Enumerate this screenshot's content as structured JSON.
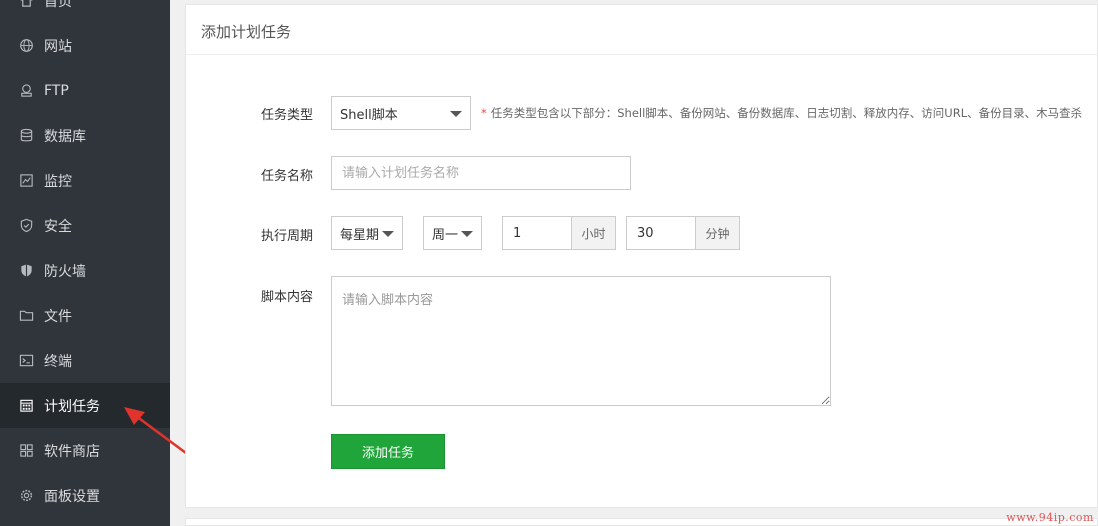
{
  "sidebar": {
    "items": [
      {
        "label": "首页",
        "icon": "home-icon"
      },
      {
        "label": "网站",
        "icon": "globe-icon"
      },
      {
        "label": "FTP",
        "icon": "ftp-icon"
      },
      {
        "label": "数据库",
        "icon": "database-icon"
      },
      {
        "label": "监控",
        "icon": "monitor-icon"
      },
      {
        "label": "安全",
        "icon": "shield-icon"
      },
      {
        "label": "防火墙",
        "icon": "firewall-icon"
      },
      {
        "label": "文件",
        "icon": "folder-icon"
      },
      {
        "label": "终端",
        "icon": "terminal-icon"
      },
      {
        "label": "计划任务",
        "icon": "calendar-icon",
        "active": true
      },
      {
        "label": "软件商店",
        "icon": "grid-icon"
      },
      {
        "label": "面板设置",
        "icon": "gear-icon"
      }
    ]
  },
  "panel": {
    "title": "添加计划任务"
  },
  "form": {
    "task_type": {
      "label": "任务类型",
      "value": "Shell脚本",
      "hint_star": "*",
      "hint": "任务类型包含以下部分：Shell脚本、备份网站、备份数据库、日志切割、释放内存、访问URL、备份目录、木马查杀"
    },
    "task_name": {
      "label": "任务名称",
      "placeholder": "请输入计划任务名称"
    },
    "period": {
      "label": "执行周期",
      "cycle": "每星期",
      "weekday": "周一",
      "hour": "1",
      "hour_unit": "小时",
      "minute": "30",
      "minute_unit": "分钟"
    },
    "script": {
      "label": "脚本内容",
      "placeholder": "请输入脚本内容"
    },
    "submit_label": "添加任务"
  },
  "colors": {
    "sidebar_bg": "#30353b",
    "sidebar_active_bg": "#24292e",
    "primary_button": "#20a53a",
    "arrow": "#e0332b",
    "hint_star": "#e74c3c"
  },
  "watermark": "www.94ip.com"
}
